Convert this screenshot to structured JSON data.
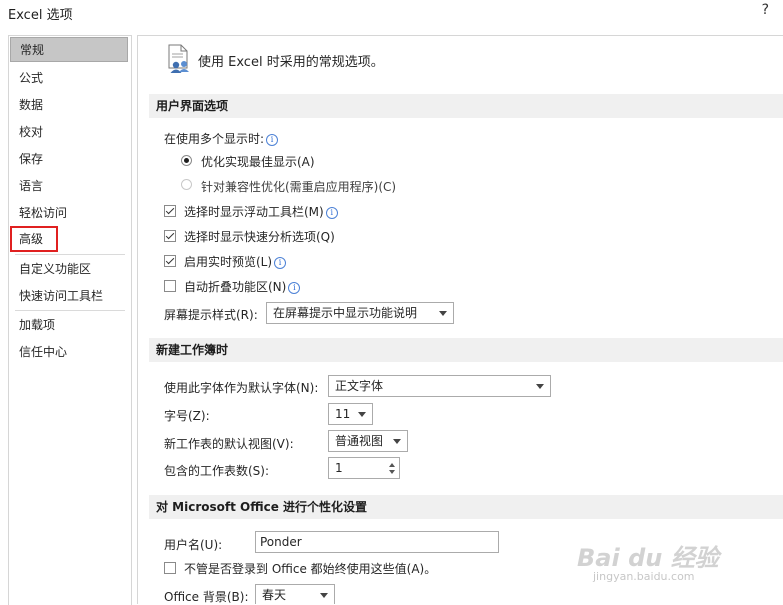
{
  "window": {
    "title": "Excel 选项",
    "help": "?"
  },
  "sidebar": {
    "items": [
      {
        "label": "常规"
      },
      {
        "label": "公式"
      },
      {
        "label": "数据"
      },
      {
        "label": "校对"
      },
      {
        "label": "保存"
      },
      {
        "label": "语言"
      },
      {
        "label": "轻松访问"
      },
      {
        "label": "高级"
      },
      {
        "label": "自定义功能区"
      },
      {
        "label": "快速访问工具栏"
      },
      {
        "label": "加载项"
      },
      {
        "label": "信任中心"
      }
    ]
  },
  "intro": {
    "text": "使用 Excel 时采用的常规选项。"
  },
  "ui_section": {
    "title": "用户界面选项",
    "multi_display_label": "在使用多个显示时:",
    "radio_optimize": "优化实现最佳显示(A)",
    "radio_compat": "针对兼容性优化(需重启应用程序)(C)",
    "check_minitoolbar": "选择时显示浮动工具栏(M)",
    "check_quickanalysis": "选择时显示快速分析选项(Q)",
    "check_livepreview": "启用实时预览(L)",
    "check_collapse_ribbon": "自动折叠功能区(N)",
    "screentip_label": "屏幕提示样式(R):",
    "screentip_value": "在屏幕提示中显示功能说明"
  },
  "workbook_section": {
    "title": "新建工作簿时",
    "font_label": "使用此字体作为默认字体(N):",
    "font_value": "正文字体",
    "size_label": "字号(Z):",
    "size_value": "11",
    "view_label": "新工作表的默认视图(V):",
    "view_value": "普通视图",
    "sheets_label": "包含的工作表数(S):",
    "sheets_value": "1"
  },
  "personalize_section": {
    "title": "对 Microsoft Office 进行个性化设置",
    "username_label": "用户名(U):",
    "username_value": "Ponder",
    "always_use_label": "不管是否登录到 Office 都始终使用这些值(A)。",
    "background_label": "Office 背景(B):",
    "background_value": "春天"
  },
  "watermark": {
    "main": "Bai du 经验",
    "sub": "jingyan.baidu.com"
  },
  "colors": {
    "selected_bg": "#c6c6c6",
    "section_bg": "#f0f0f0",
    "highlight": "#e02020",
    "info": "#2c6bd4"
  }
}
